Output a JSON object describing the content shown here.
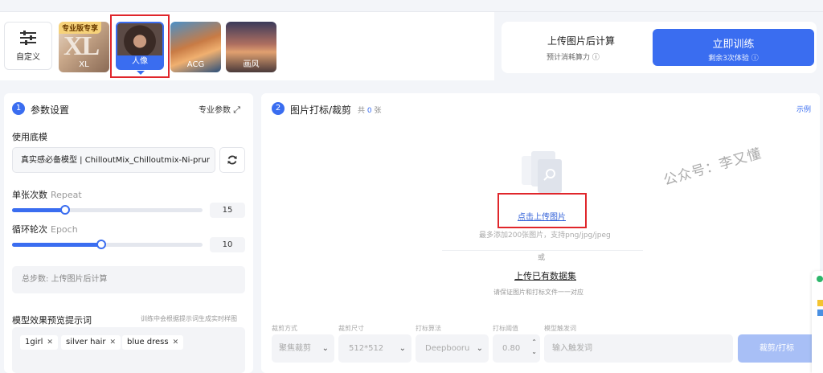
{
  "models": {
    "custom_label": "自定义",
    "items": [
      {
        "badge": "专业版专享",
        "title": "XL",
        "label": "XL"
      },
      {
        "label": "人像"
      },
      {
        "label": "ACG"
      },
      {
        "label": "画风"
      }
    ]
  },
  "top_right": {
    "calc_title": "上传图片后计算",
    "calc_sub": "预计消耗算力",
    "train_label": "立即训练",
    "train_sub": "剩余3次体验"
  },
  "params": {
    "step_num": "1",
    "title": "参数设置",
    "pro_link": "专业参数",
    "base_model_label": "使用底模",
    "base_model_value": "真实感必备模型 | ChilloutMix_Chilloutmix-Ni-prur",
    "repeat_label": "单张次数",
    "repeat_en": "Repeat",
    "repeat_value": "15",
    "repeat_fraction": 0.28,
    "epoch_label": "循环轮次",
    "epoch_en": "Epoch",
    "epoch_value": "10",
    "epoch_fraction": 0.47,
    "total_steps_text": "总步数: 上传图片后计算",
    "prompt_label": "模型效果预览提示词",
    "prompt_hint": "训练中会根据提示词生成实时样图",
    "tags": [
      "1girl",
      "silver hair",
      "blue dress"
    ]
  },
  "upload": {
    "step_num": "2",
    "title": "图片打标/裁剪",
    "count_prefix": "共",
    "count": "0",
    "count_suffix": "张",
    "example_link": "示例",
    "upload_link": "点击上传图片",
    "upload_hint": "最多添加200张图片，支持png/jpg/jpeg",
    "or": "或",
    "dataset_link": "上传已有数据集",
    "dataset_hint": "请保证图片和打标文件一一对应",
    "watermark": "公众号：李又懂"
  },
  "controls": {
    "crop_mode_label": "裁剪方式",
    "crop_mode_value": "聚焦裁剪",
    "crop_size_label": "裁剪尺寸",
    "crop_size_value": "512*512",
    "tag_algo_label": "打标算法",
    "tag_algo_value": "Deepbooru",
    "threshold_label": "打标阈值",
    "threshold_value": "0.80",
    "trigger_label": "模型触发词",
    "trigger_placeholder": "输入触发词",
    "crop_button": "裁剪/打标"
  },
  "colors": {
    "accent": "#3a6df0",
    "highlight": "#e0262b"
  }
}
